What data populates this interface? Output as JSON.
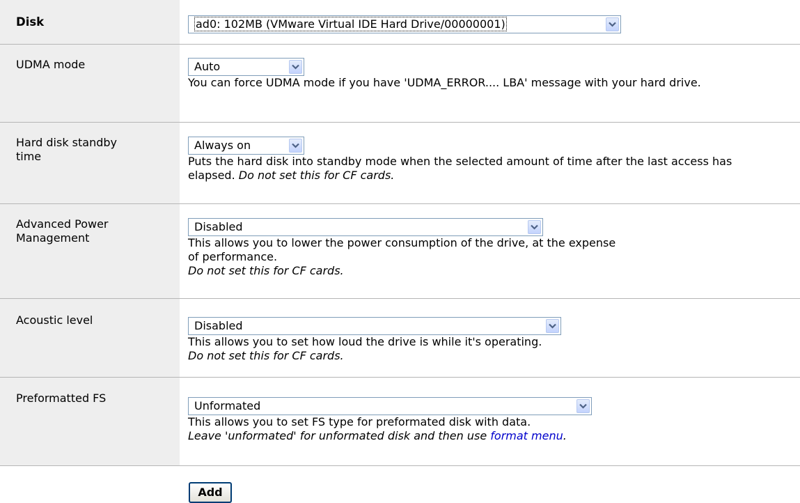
{
  "form": {
    "rows": [
      {
        "label": "Disk",
        "select_value": "ad0: 102MB (VMware Virtual IDE Hard Drive/00000001)"
      },
      {
        "label": "UDMA mode",
        "select_value": "Auto",
        "description": "You can force UDMA mode if you have 'UDMA_ERROR.... LBA' message with your hard drive."
      },
      {
        "label": "Hard disk standby time",
        "select_value": "Always on",
        "description": "Puts the hard disk into standby mode when the selected amount of time after the last access has elapsed.",
        "note": "Do not set this for CF cards."
      },
      {
        "label": "Advanced Power Management",
        "select_value": "Disabled",
        "description": "This allows you to lower the power consumption of the drive, at the expense of performance.",
        "note": "Do not set this for CF cards."
      },
      {
        "label": "Acoustic level",
        "select_value": "Disabled",
        "description": "This allows you to set how loud the drive is while it's operating.",
        "note": "Do not set this for CF cards."
      },
      {
        "label": "Preformatted FS",
        "select_value": "Unformated",
        "description": "This allows you to set FS type for preformated disk with data.",
        "note": "Leave 'unformated' for unformated disk and then use",
        "link_text": "format menu",
        "note_end": "."
      }
    ],
    "add_button_label": "Add"
  },
  "icons": {
    "dropdown_arrow": "chevron-down-icon"
  },
  "colors": {
    "label_background": "#eeeeee",
    "row_divider": "#b5b5b5",
    "link": "#0000cc",
    "select_border": "#7f9db9",
    "button_border": "#003c74"
  }
}
